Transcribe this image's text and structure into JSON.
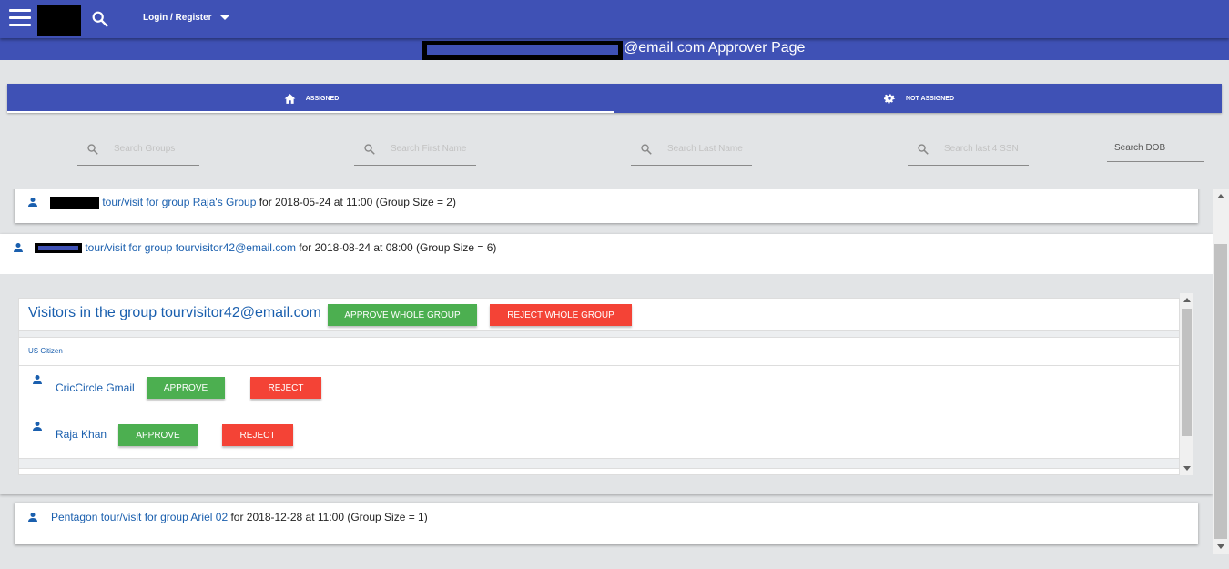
{
  "header": {
    "login_label": "Login / Register"
  },
  "title": {
    "text": "@email.com Approver Page"
  },
  "tabs": [
    {
      "label": "ASSIGNED",
      "icon": "home-icon",
      "active": true
    },
    {
      "label": "NOT ASSIGNED",
      "icon": "gear-icon",
      "active": false
    }
  ],
  "search": {
    "groups_placeholder": "Search Groups",
    "first_name_placeholder": "Search First Name",
    "last_name_placeholder": "Search Last Name",
    "ssn_placeholder": "Search last 4 SSN",
    "dob_placeholder": "Search DOB"
  },
  "tours": [
    {
      "link": "tour/visit for group Raja's Group",
      "details": "for 2018-05-24 at 11:00 (Group Size = 2)"
    },
    {
      "link": "tour/visit for group tourvisitor42@email.com",
      "details": "for 2018-08-24 at 08:00 (Group Size = 6)"
    },
    {
      "link": "Pentagon tour/visit for group Ariel 02",
      "details": "for 2018-12-28 at 11:00 (Group Size = 1)"
    }
  ],
  "visitors_panel": {
    "title": "Visitors in the group tourvisitor42@email.com",
    "approve_all_label": "APPROVE WHOLE GROUP",
    "reject_all_label": "REJECT WHOLE GROUP",
    "column_header": "US Citizen",
    "visitors": [
      {
        "name": "CricCircle Gmail",
        "approve_label": "APPROVE",
        "reject_label": "REJECT"
      },
      {
        "name": "Raja Khan",
        "approve_label": "APPROVE",
        "reject_label": "REJECT"
      }
    ]
  },
  "colors": {
    "primary": "#3f51b5",
    "approve": "#4caf50",
    "reject": "#f44336",
    "link": "#1a5fae"
  }
}
